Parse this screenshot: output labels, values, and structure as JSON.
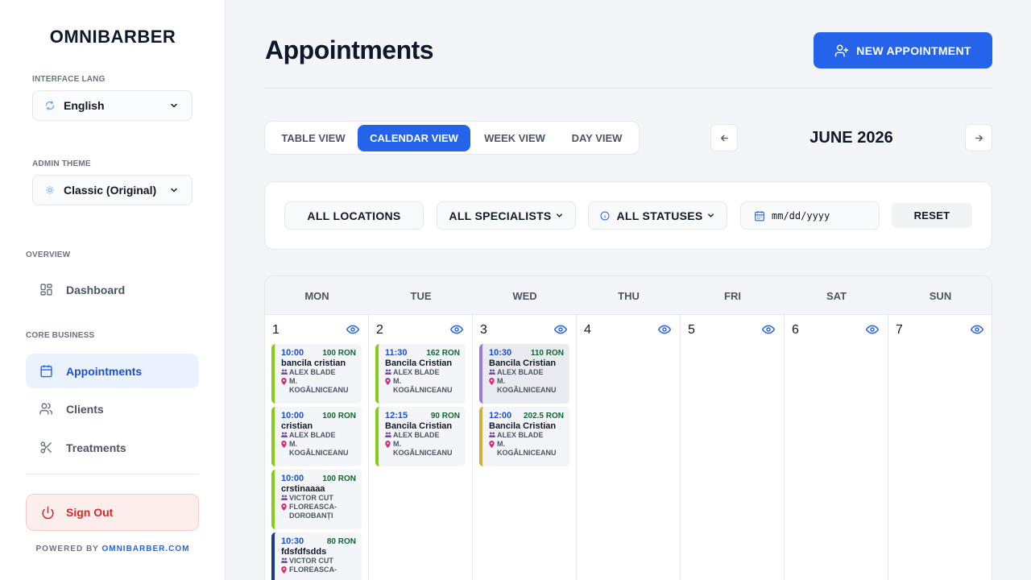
{
  "sidebar": {
    "brand": "OMNIBARBER",
    "interface_lang_label": "INTERFACE LANG",
    "interface_lang_value": "English",
    "admin_theme_label": "ADMIN THEME",
    "admin_theme_value": "Classic (Original)",
    "overview_label": "OVERVIEW",
    "dashboard": "Dashboard",
    "core_label": "CORE BUSINESS",
    "appointments": "Appointments",
    "clients": "Clients",
    "treatments": "Treatments",
    "sign_out": "Sign Out",
    "powered_by": "POWERED BY",
    "powered_link": "OMNIBARBER.COM"
  },
  "header": {
    "title": "Appointments",
    "new_button": "NEW APPOINTMENT"
  },
  "views": {
    "table": "TABLE VIEW",
    "calendar": "CALENDAR VIEW",
    "week": "WEEK VIEW",
    "day": "DAY VIEW"
  },
  "month_label": "JUNE 2026",
  "filters": {
    "locations": "ALL LOCATIONS",
    "specialists": "ALL SPECIALISTS",
    "statuses": "ALL STATUSES",
    "date_placeholder": "mm/dd/yyyy",
    "reset": "RESET"
  },
  "calendar": {
    "weekdays": [
      "MON",
      "TUE",
      "WED",
      "THU",
      "FRI",
      "SAT",
      "SUN"
    ],
    "days": [
      "1",
      "2",
      "3",
      "4",
      "5",
      "6",
      "7"
    ],
    "appointments": {
      "mon": [
        {
          "time": "10:00",
          "price": "100 RON",
          "client": "bancila cristian",
          "specialist": "ALEX BLADE",
          "location": "M. KOGĂLNICEANU"
        },
        {
          "time": "10:00",
          "price": "100 RON",
          "client": "cristian",
          "specialist": "ALEX BLADE",
          "location": "M. KOGĂLNICEANU"
        },
        {
          "time": "10:00",
          "price": "100 RON",
          "client": "crstinaaaa",
          "specialist": "VICTOR CUT",
          "location": "FLOREASCA-DOROBANȚI"
        },
        {
          "time": "10:30",
          "price": "80 RON",
          "client": "fdsfdfsdds",
          "specialist": "VICTOR CUT",
          "location": "FLOREASCA-"
        }
      ],
      "tue": [
        {
          "time": "11:30",
          "price": "162 RON",
          "client": "Bancila Cristian",
          "specialist": "ALEX BLADE",
          "location": "M. KOGĂLNICEANU"
        },
        {
          "time": "12:15",
          "price": "90 RON",
          "client": "Bancila Cristian",
          "specialist": "ALEX BLADE",
          "location": "M. KOGĂLNICEANU"
        }
      ],
      "wed": [
        {
          "time": "10:30",
          "price": "110 RON",
          "client": "Bancila Cristian",
          "specialist": "ALEX BLADE",
          "location": "M. KOGĂLNICEANU"
        },
        {
          "time": "12:00",
          "price": "202.5 RON",
          "client": "Bancila Cristian",
          "specialist": "ALEX BLADE",
          "location": "M. KOGĂLNICEANU"
        }
      ]
    }
  },
  "colors": {
    "accent": "#2563eb",
    "danger": "#dc2626",
    "appt_green": "#84cc16",
    "appt_purple": "#9b7ed1",
    "appt_gold": "#cfae3d",
    "appt_navy": "#1e3a8a"
  },
  "icons": {
    "lang": "refresh-icon",
    "theme": "palette-icon",
    "dashboard": "grid-icon",
    "appointments": "calendar-icon",
    "clients": "users-icon",
    "treatments": "scissors-icon",
    "sign_out": "power-icon",
    "new": "user-plus-icon",
    "eye": "eye-icon"
  }
}
